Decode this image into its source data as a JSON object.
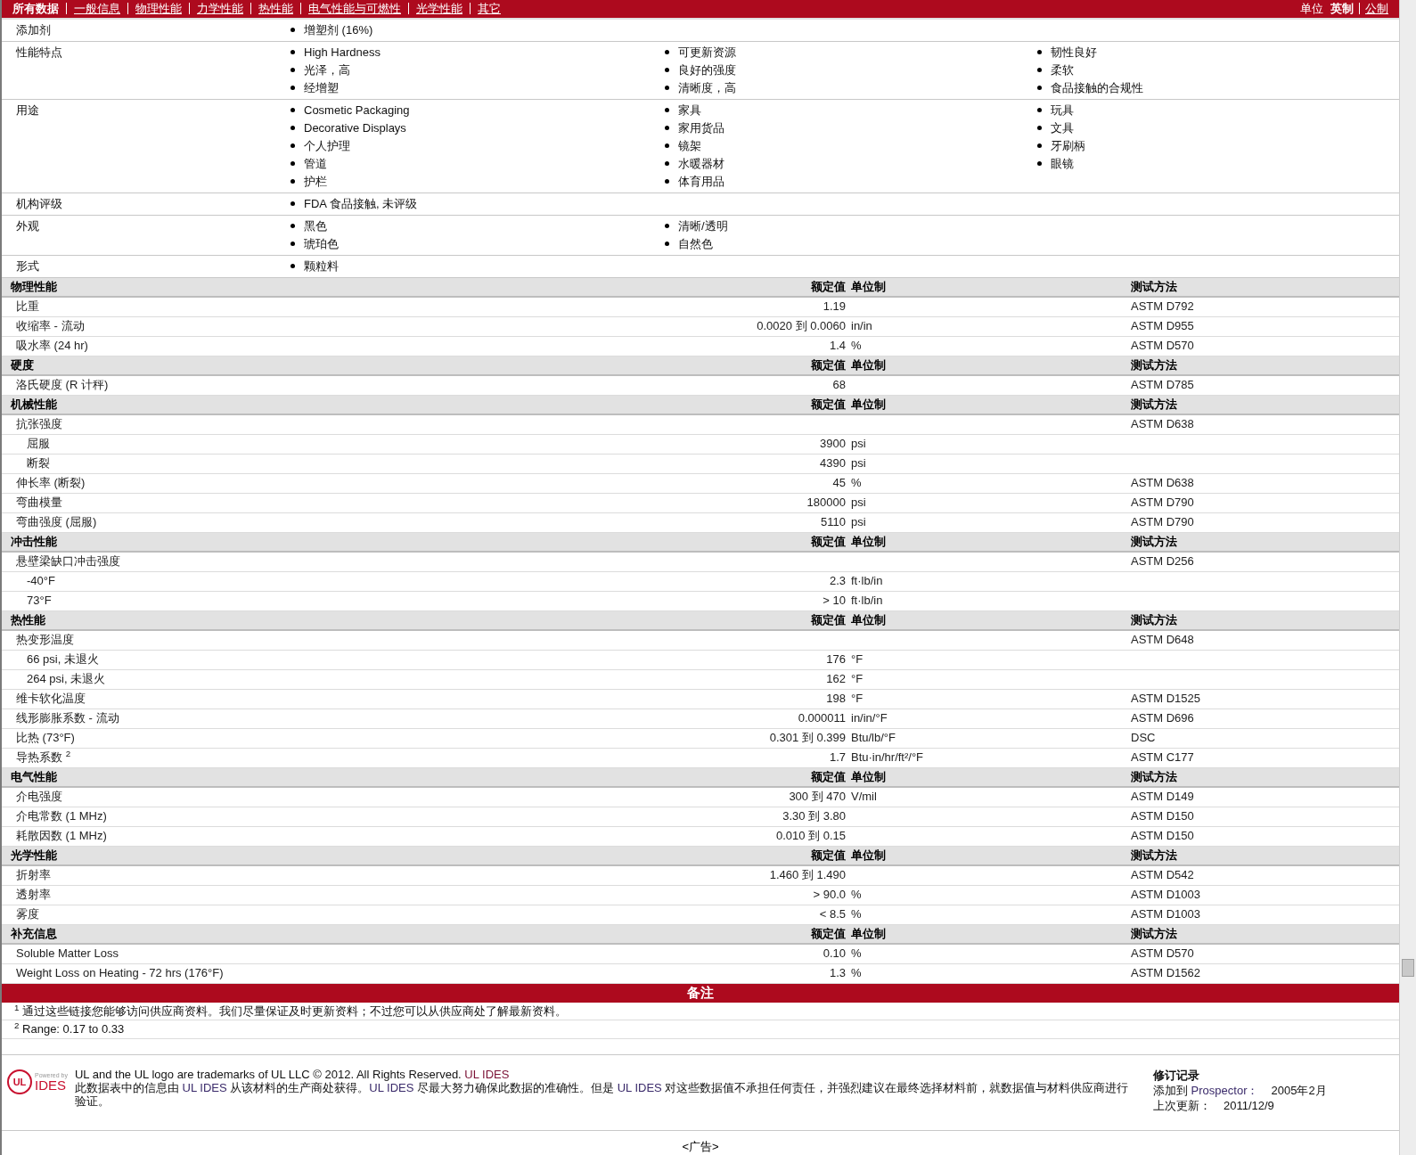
{
  "nav": {
    "tabs": [
      {
        "label": "所有数据",
        "selected": true
      },
      {
        "label": "一般信息",
        "selected": false
      },
      {
        "label": "物理性能",
        "selected": false
      },
      {
        "label": "力学性能",
        "selected": false
      },
      {
        "label": "热性能",
        "selected": false
      },
      {
        "label": "电气性能与可燃性",
        "selected": false
      },
      {
        "label": "光学性能",
        "selected": false
      },
      {
        "label": "其它",
        "selected": false
      }
    ],
    "units_label": "单位",
    "units": [
      {
        "label": "英制",
        "selected": true
      },
      {
        "label": "公制",
        "selected": false
      }
    ]
  },
  "info": [
    {
      "label": "添加剂",
      "columns": [
        [
          "增塑剂 (16%)"
        ]
      ]
    },
    {
      "label": "性能特点",
      "columns": [
        [
          "High Hardness",
          "光泽，高",
          "经增塑"
        ],
        [
          "可更新资源",
          "良好的强度",
          "清晰度，高"
        ],
        [
          "韧性良好",
          "柔软",
          "食品接触的合规性"
        ]
      ]
    },
    {
      "label": "用途",
      "columns": [
        [
          "Cosmetic Packaging",
          "Decorative Displays",
          "个人护理",
          "管道",
          "护栏"
        ],
        [
          "家具",
          "家用货品",
          "镜架",
          "水暖器材",
          "体育用品"
        ],
        [
          "玩具",
          "文具",
          "牙刷柄",
          "眼镜"
        ]
      ]
    },
    {
      "label": "机构评级",
      "columns": [
        [
          "FDA 食品接触, 未评级"
        ]
      ]
    },
    {
      "label": "外观",
      "columns": [
        [
          "黑色",
          "琥珀色"
        ],
        [
          "清晰/透明",
          "自然色"
        ]
      ]
    },
    {
      "label": "形式",
      "columns": [
        [
          "颗粒料"
        ]
      ]
    }
  ],
  "sections": [
    {
      "title": "物理性能",
      "value_header": "额定值",
      "unit_header": "单位制",
      "method_header": "测试方法",
      "rows": [
        {
          "name": "比重",
          "value": "1.19",
          "method": "ASTM D792"
        },
        {
          "name": "收缩率  - 流动",
          "value": "0.0020 到  0.0060",
          "unit": "in/in",
          "method": "ASTM D955"
        },
        {
          "name": "吸水率  (24 hr)",
          "value": "1.4",
          "unit": "%",
          "method": "ASTM D570"
        }
      ]
    },
    {
      "title": "硬度",
      "value_header": "额定值",
      "unit_header": "单位制",
      "method_header": "测试方法",
      "rows": [
        {
          "name": "洛氏硬度  (R 计秤)",
          "value": "68",
          "method": "ASTM D785"
        }
      ]
    },
    {
      "title": "机械性能",
      "value_header": "额定值",
      "unit_header": "单位制",
      "method_header": "测试方法",
      "rows": [
        {
          "name": "抗张强度",
          "method": "ASTM D638",
          "children": [
            {
              "name": "屈服",
              "value": "3900",
              "unit": "psi"
            },
            {
              "name": "断裂",
              "value": "4390",
              "unit": "psi"
            }
          ]
        },
        {
          "name": "伸长率  (断裂)",
          "value": "45",
          "unit": "%",
          "method": "ASTM D638"
        },
        {
          "name": "弯曲模量",
          "value": "180000",
          "unit": "psi",
          "method": "ASTM D790"
        },
        {
          "name": "弯曲强度  (屈服)",
          "value": "5110",
          "unit": "psi",
          "method": "ASTM D790"
        }
      ]
    },
    {
      "title": "冲击性能",
      "value_header": "额定值",
      "unit_header": "单位制",
      "method_header": "测试方法",
      "rows": [
        {
          "name": "悬壁梁缺口冲击强度",
          "method": "ASTM D256",
          "children": [
            {
              "name": "-40°F",
              "value": "2.3",
              "unit": "ft·lb/in"
            },
            {
              "name": "73°F",
              "value": "> 10",
              "unit": "ft·lb/in"
            }
          ]
        }
      ]
    },
    {
      "title": "热性能",
      "value_header": "额定值",
      "unit_header": "单位制",
      "method_header": "测试方法",
      "rows": [
        {
          "name": "热变形温度",
          "method": "ASTM D648",
          "children": [
            {
              "name": "66 psi, 未退火",
              "value": "176",
              "unit": "°F"
            },
            {
              "name": "264 psi, 未退火",
              "value": "162",
              "unit": "°F"
            }
          ]
        },
        {
          "name": "维卡软化温度",
          "value": "198",
          "unit": "°F",
          "method": "ASTM D1525"
        },
        {
          "name": "线形膨胀系数  - 流动",
          "value": "0.000011",
          "unit": "in/in/°F",
          "method": "ASTM D696"
        },
        {
          "name": "比热  (73°F)",
          "value": "0.301 到  0.399",
          "unit": "Btu/lb/°F",
          "method": "DSC"
        },
        {
          "name": "导热系数 $^{2}$",
          "value": "1.7",
          "unit": "Btu·in/hr/ft²/°F",
          "method": "ASTM C177"
        }
      ]
    },
    {
      "title": "电气性能",
      "value_header": "额定值",
      "unit_header": "单位制",
      "method_header": "测试方法",
      "rows": [
        {
          "name": "介电强度",
          "value": "300 到  470",
          "unit": "V/mil",
          "method": "ASTM D149"
        },
        {
          "name": "介电常数  (1 MHz)",
          "value": "3.30 到  3.80",
          "method": "ASTM D150"
        },
        {
          "name": "耗散因数  (1 MHz)",
          "value": "0.010 到  0.15",
          "method": "ASTM D150"
        }
      ]
    },
    {
      "title": "光学性能",
      "value_header": "额定值",
      "unit_header": "单位制",
      "method_header": "测试方法",
      "rows": [
        {
          "name": "折射率",
          "value": "1.460 到  1.490",
          "method": "ASTM D542"
        },
        {
          "name": "透射率",
          "value": "> 90.0",
          "unit": "%",
          "method": "ASTM D1003"
        },
        {
          "name": "雾度",
          "value": "< 8.5",
          "unit": "%",
          "method": "ASTM D1003"
        }
      ]
    },
    {
      "title": "补充信息",
      "value_header": "额定值",
      "unit_header": "单位制",
      "method_header": "测试方法",
      "rows": [
        {
          "name": "Soluble Matter Loss",
          "value": "0.10",
          "unit": "%",
          "method": "ASTM D570"
        },
        {
          "name": "Weight Loss on Heating - 72 hrs (176°F)",
          "value": "1.3",
          "unit": "%",
          "method": "ASTM D1562"
        }
      ]
    }
  ],
  "notes": {
    "title": "备注",
    "items": [
      "$^{1}$ 通过这些链接您能够访问供应商资料。我们尽量保证及时更新资料；不过您可以从供应商处了解最新资料。",
      "$^{2}$ Range: 0.17 to 0.33"
    ]
  },
  "footer": {
    "logo": {
      "powered": "Powered by",
      "mark": "UL",
      "brand": "IDES"
    },
    "trademark": [
      {
        "text": "UL and the UL logo are trademarks of UL LLC © 2012. All Rights Reserved. ",
        "link": false
      },
      {
        "text": "UL IDES",
        "link": true
      }
    ],
    "disclaimer": [
      {
        "text": "此数据表中的信息由 ",
        "link": false
      },
      {
        "text": "UL IDES",
        "link": true
      },
      {
        "text": " 从该材料的生产商处获得。",
        "link": false
      },
      {
        "text": "UL IDES",
        "link": true
      },
      {
        "text": " 尽最大努力确保此数据的准确性。但是 ",
        "link": false
      },
      {
        "text": "UL IDES",
        "link": true
      },
      {
        "text": " 对这些数据值不承担任何责任，并强烈建议在最终选择材料前，就数据值与材料供应商进行验证。",
        "link": false
      }
    ],
    "revision": {
      "title": "修订记录",
      "rows": [
        {
          "label": "添加到 ",
          "link": "Prospector：",
          "value": "2005年2月"
        },
        {
          "label": "上次更新：",
          "value": "2011/12/9"
        }
      ]
    }
  },
  "ad": "<广告>"
}
